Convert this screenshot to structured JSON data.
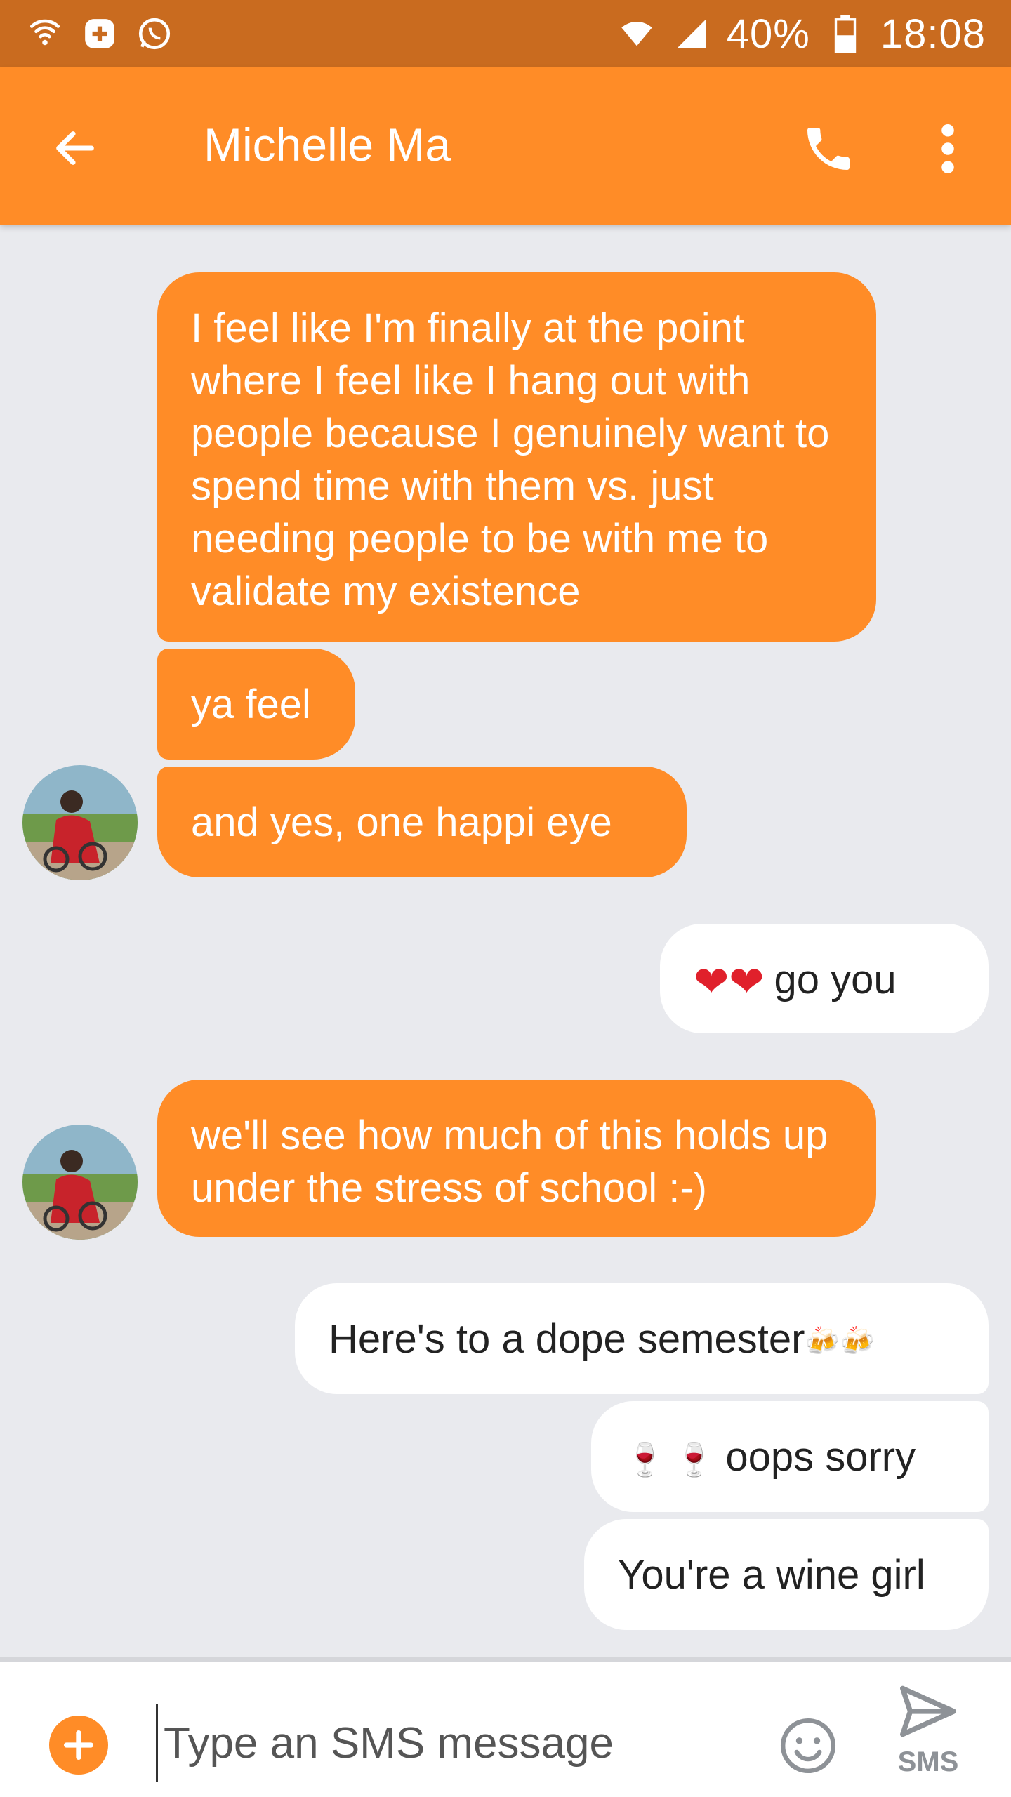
{
  "status_bar": {
    "battery": "40%",
    "time": "18:08"
  },
  "app_bar": {
    "title": "Michelle Ma"
  },
  "messages": [
    {
      "dir": "in",
      "text": "I feel like I'm finally at the point where I feel like I hang out with people because I genuinely want to spend time with them vs. just needing people to be with me to validate my existence"
    },
    {
      "dir": "in",
      "text": "ya feel"
    },
    {
      "dir": "in",
      "text": "and yes, one happi eye"
    },
    {
      "dir": "out",
      "text": "go you",
      "emoji": "❤❤"
    },
    {
      "dir": "in",
      "text": "we'll see how much of this holds up under the stress of school :-)"
    },
    {
      "dir": "out",
      "text": "Here's to a dope semester",
      "emoji": "🍻🍻"
    },
    {
      "dir": "out",
      "text": "oops sorry",
      "emoji": "🍷 🍷"
    },
    {
      "dir": "out",
      "text": "You're a wine girl"
    }
  ],
  "composer": {
    "placeholder": "Type an SMS message",
    "send_label": "SMS"
  },
  "colors": {
    "accent": "#FF8C27",
    "status_bar": "#C96B1F",
    "background": "#E9EAEE"
  }
}
